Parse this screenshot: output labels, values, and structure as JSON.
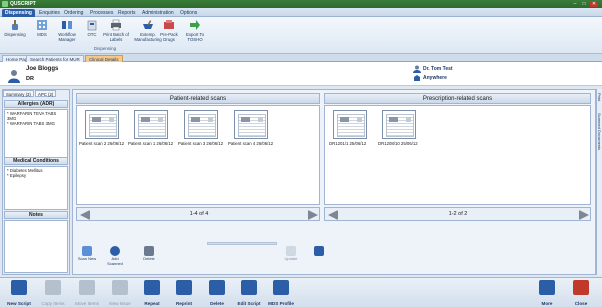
{
  "app": {
    "title": "QUSCRIPT",
    "window_controls": {
      "minimize": "–",
      "maximize": "□",
      "close": "✕"
    }
  },
  "menu_tabs": [
    "Dispensing",
    "Enquiries",
    "Ordering",
    "Processes",
    "Reports",
    "Administration",
    "Options"
  ],
  "ribbon": {
    "buttons": [
      "Dispensing",
      "MDS",
      "Workflow Manager",
      "OTC",
      "Print Batch of Labels",
      "Extemp. Manufacturing",
      "Pre-Pack Drugs",
      "Export To TOSHO"
    ],
    "group_label": "Dispensing"
  },
  "document_tabs": [
    "Home Page",
    "Search Patients for MUR",
    "Clinical Details"
  ],
  "patient": {
    "name": "Joe Bloggs",
    "title": "DR",
    "doctor": "Dr. Tom Test",
    "location": "Anywhere"
  },
  "left_panel": {
    "tabs": [
      "Summary (3)",
      "APC (2)"
    ],
    "allergies": {
      "header": "Allergies (ADR)",
      "items": [
        "* WARFARIN TEVA TABS 3MG",
        "* WARFARIN TABS 3MG"
      ]
    },
    "conditions": {
      "header": "Medical Conditions",
      "items": [
        "* Diabetes Mellitus",
        "* Epilepsy"
      ]
    },
    "notes": {
      "header": "Notes"
    }
  },
  "patient_scans": {
    "header": "Patient-related scans",
    "items": [
      "Patient scan 2 26/06/12",
      "Patient scan 1 26/06/12",
      "Patient scan 3 26/06/12",
      "Patient scan 4 26/06/12"
    ],
    "pager": "1-4 of 4",
    "buttons": [
      "Scan New",
      "Add Scanned",
      "Delete"
    ]
  },
  "prescription_scans": {
    "header": "Prescription-related scans",
    "items": [
      "DR1201/1   25/06/12",
      "DR1208/10   25/06/12"
    ],
    "pager": "1-2 of 2",
    "buttons": [
      "Update"
    ]
  },
  "side_tabs": [
    "Print",
    "Scanned Documents"
  ],
  "bottom_toolbar": [
    {
      "label": "New Script",
      "enabled": true
    },
    {
      "label": "Copy Items",
      "enabled": false
    },
    {
      "label": "Move Items",
      "enabled": false
    },
    {
      "label": "New Issue",
      "enabled": false
    },
    {
      "label": "Repeat",
      "enabled": true
    },
    {
      "label": "Reprint",
      "enabled": true
    },
    {
      "label": "Delete",
      "enabled": true
    },
    {
      "label": "Edit Script",
      "enabled": true
    },
    {
      "label": "MDS Profile",
      "enabled": true
    },
    {
      "label": "More",
      "enabled": true
    },
    {
      "label": "Close",
      "enabled": true
    }
  ],
  "colors": {
    "accent": "#2c5ea8",
    "title_green": "#2d6a2d",
    "active_doc_tab": "#f7c98a",
    "close_red": "#c0392b"
  }
}
